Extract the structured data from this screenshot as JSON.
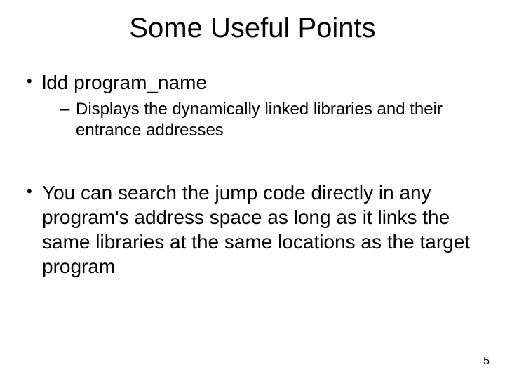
{
  "title": "Some Useful Points",
  "bullets": {
    "b1": "ldd program_name",
    "b1sub": "Displays the dynamically linked libraries and their entrance addresses",
    "b2": "You can search the jump code directly in any program's address space as long as it links the same libraries at the same locations as the target program"
  },
  "page": "5"
}
